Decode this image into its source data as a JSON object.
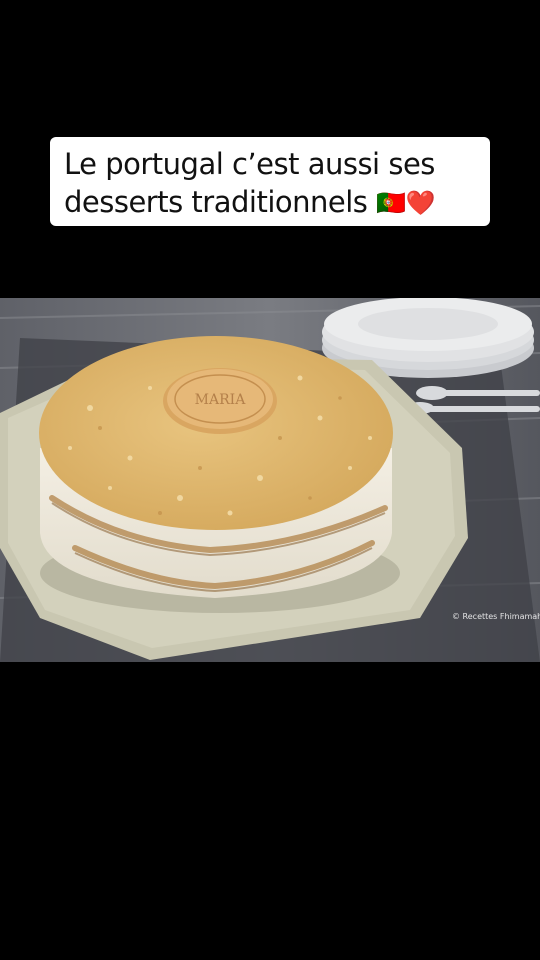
{
  "caption": {
    "line1": "Le portugal c’est aussi ses",
    "line2_text": "desserts traditionnels",
    "line2_emojis": "🇵🇹❤️"
  },
  "photo": {
    "subject": "biscuit-cake",
    "watermark": "© Recettes Fhimamah"
  }
}
